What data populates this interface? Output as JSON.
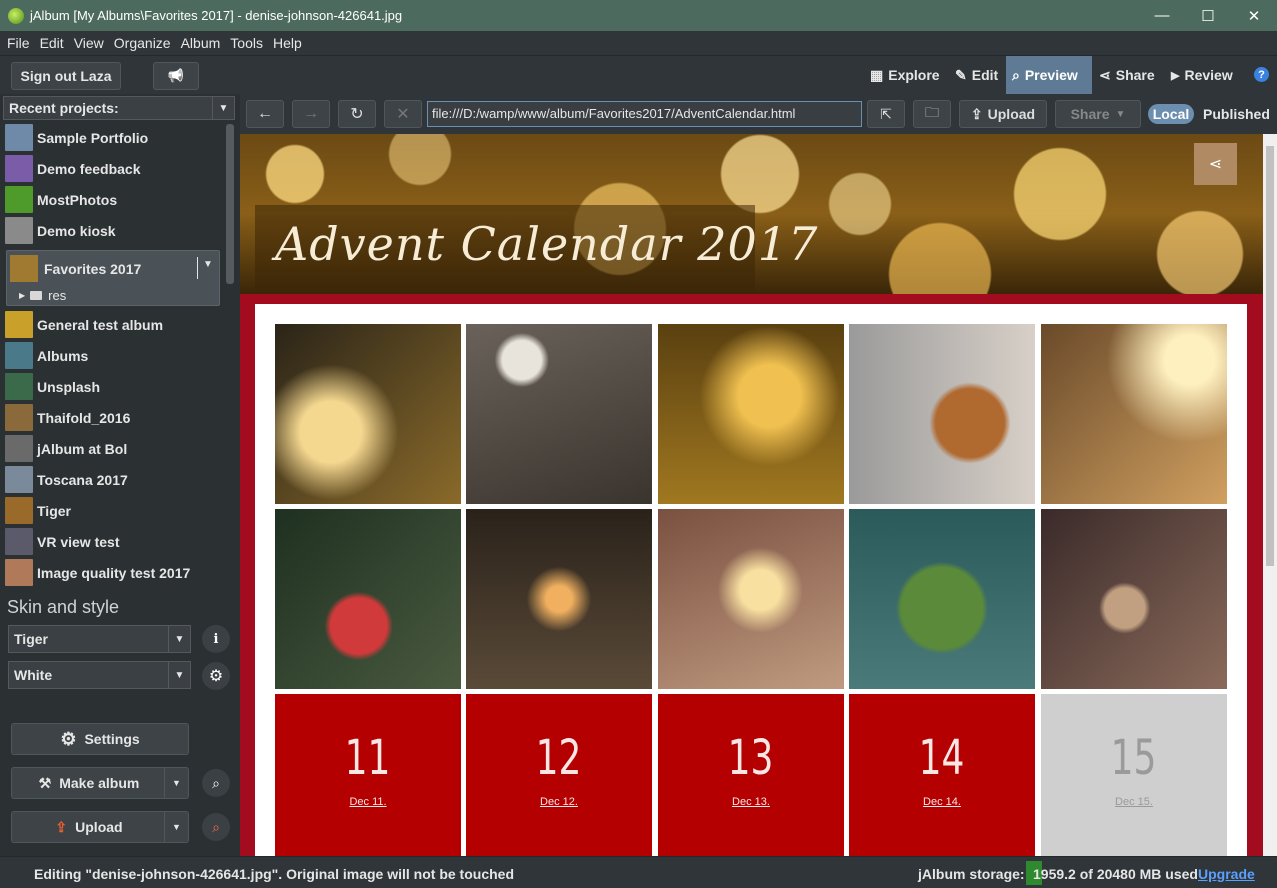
{
  "window": {
    "title": "jAlbum [My Albums\\Favorites 2017] - denise-johnson-426641.jpg",
    "minimize": "—",
    "maximize": "☐",
    "close": "✕"
  },
  "menu": [
    "File",
    "Edit",
    "View",
    "Organize",
    "Album",
    "Tools",
    "Help"
  ],
  "toolbar": {
    "sign_out": "Sign out Laza",
    "announce_icon": "📢",
    "tabs": [
      {
        "label": "Explore",
        "icon": "grid-icon",
        "glyph": "▦"
      },
      {
        "label": "Edit",
        "icon": "pencil-icon",
        "glyph": "✎"
      },
      {
        "label": "Preview",
        "icon": "magnifier-icon",
        "glyph": "⌕"
      },
      {
        "label": "Share",
        "icon": "share-icon",
        "glyph": "⋖"
      },
      {
        "label": "Review",
        "icon": "play-icon",
        "glyph": "▶"
      }
    ],
    "help_glyph": "?"
  },
  "sidebar": {
    "recent_header": "Recent projects:",
    "projects": [
      {
        "label": "Sample Portfolio",
        "color": "#6f8aa8"
      },
      {
        "label": "Demo feedback",
        "color": "#7b5ca8"
      },
      {
        "label": "MostPhotos",
        "color": "#4e9a2a"
      },
      {
        "label": "Demo kiosk",
        "color": "#8a8a8a"
      },
      {
        "label": "Favorites 2017",
        "color": "#a07a30"
      },
      {
        "label": "General test album",
        "color": "#c9a12a"
      },
      {
        "label": "Albums",
        "color": "#4a7a8a"
      },
      {
        "label": "Unsplash",
        "color": "#3a6a4a"
      },
      {
        "label": "Thaifold_2016",
        "color": "#8a6a3a"
      },
      {
        "label": "jAlbum at Bol",
        "color": "#6a6a6a"
      },
      {
        "label": "Toscana 2017",
        "color": "#7a8a9a"
      },
      {
        "label": "Tiger",
        "color": "#9a6a2a"
      },
      {
        "label": "VR view test",
        "color": "#5a5a6a"
      },
      {
        "label": "Image quality test 2017",
        "color": "#b07a5a"
      }
    ],
    "selected_child": "res",
    "skin_title": "Skin and style",
    "skin": "Tiger",
    "style": "White",
    "settings": "Settings",
    "make_album": "Make album",
    "upload": "Upload"
  },
  "browser": {
    "url": "file:///D:/wamp/www/album/Favorites2017/AdventCalendar.html",
    "upload": "Upload",
    "share": "Share",
    "local": "Local",
    "published": "Published"
  },
  "album": {
    "title": "Advent Calendar 2017",
    "photos": [
      {
        "color": "#8a6a2a"
      },
      {
        "color": "#5a5248"
      },
      {
        "color": "#a07820"
      },
      {
        "color": "#b8a89a"
      },
      {
        "color": "#c0904a"
      },
      {
        "color": "#3a4a38"
      },
      {
        "color": "#4a3a2a"
      },
      {
        "color": "#9a7050"
      },
      {
        "color": "#3a6a6a"
      },
      {
        "color": "#6a4a3a"
      }
    ],
    "days": [
      {
        "num": "11",
        "date": "Dec 11.",
        "opened": true
      },
      {
        "num": "12",
        "date": "Dec 12.",
        "opened": true
      },
      {
        "num": "13",
        "date": "Dec 13.",
        "opened": true
      },
      {
        "num": "14",
        "date": "Dec 14.",
        "opened": true
      },
      {
        "num": "15",
        "date": "Dec 15.",
        "opened": false
      }
    ]
  },
  "status": {
    "text": "Editing \"denise-johnson-426641.jpg\". Original image will not be touched",
    "storage_label": "jAlbum storage:",
    "storage_text": "1959.2 of 20480 MB used",
    "storage_used_mb": 1959.2,
    "storage_total_mb": 20480,
    "upgrade": "Upgrade"
  }
}
